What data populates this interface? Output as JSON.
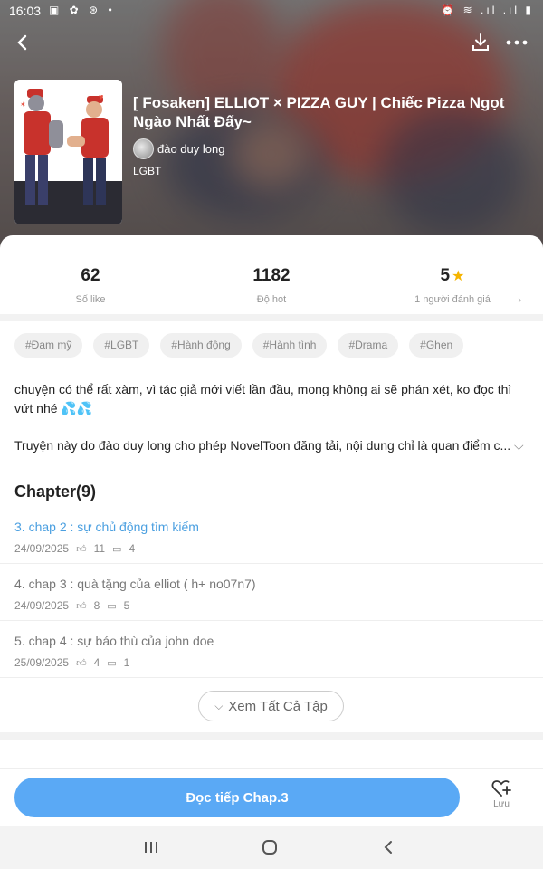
{
  "status": {
    "time": "16:03",
    "left_icons": "▣ ✿ ⊛ •",
    "right_icons": "⏰ ≋ .ıl .ıl ▮"
  },
  "book": {
    "title": "[ Fosaken] ELLIOT × PIZZA GUY | Chiếc Pizza Ngọt Ngào Nhất Đấy~",
    "author": "đào duy long",
    "genre": "LGBT"
  },
  "stats": {
    "likes": "62",
    "likes_label": "Số like",
    "hot": "1182",
    "hot_label": "Độ hot",
    "rating": "5",
    "rating_label": "1 người đánh giá"
  },
  "tags": [
    "#Đam mỹ",
    "#LGBT",
    "#Hành động",
    "#Hành tình",
    "#Drama",
    "#Ghen"
  ],
  "description": "chuyện có thể rất xàm, vì tác giả mới viết lần đầu, mong không ai sẽ phán xét, ko đọc thì vứt nhé 💦💦",
  "notice": "Truyện này do đào duy long cho phép NovelToon đăng tải, nội dung chỉ là quan điểm c...",
  "chapter_heading": "Chapter(9)",
  "chapters": [
    {
      "name": "3. chap 2 : sự chủ động tìm kiếm",
      "date": "24/09/2025",
      "likes": "11",
      "comments": "4",
      "active": true
    },
    {
      "name": "4. chap 3 : quà tặng của elliot ( h+ no07n7)",
      "date": "24/09/2025",
      "likes": "8",
      "comments": "5",
      "active": false
    },
    {
      "name": "5. chap 4 : sự báo thù của john doe",
      "date": "25/09/2025",
      "likes": "4",
      "comments": "1",
      "active": false
    }
  ],
  "see_all_label": "Xem Tất Cả Tập",
  "read_button": "Đọc tiếp Chap.3",
  "save_label": "Lưu",
  "colors": {
    "accent": "#5aa9f5",
    "active_chapter": "#4a9fe0",
    "star": "#f5b400"
  }
}
